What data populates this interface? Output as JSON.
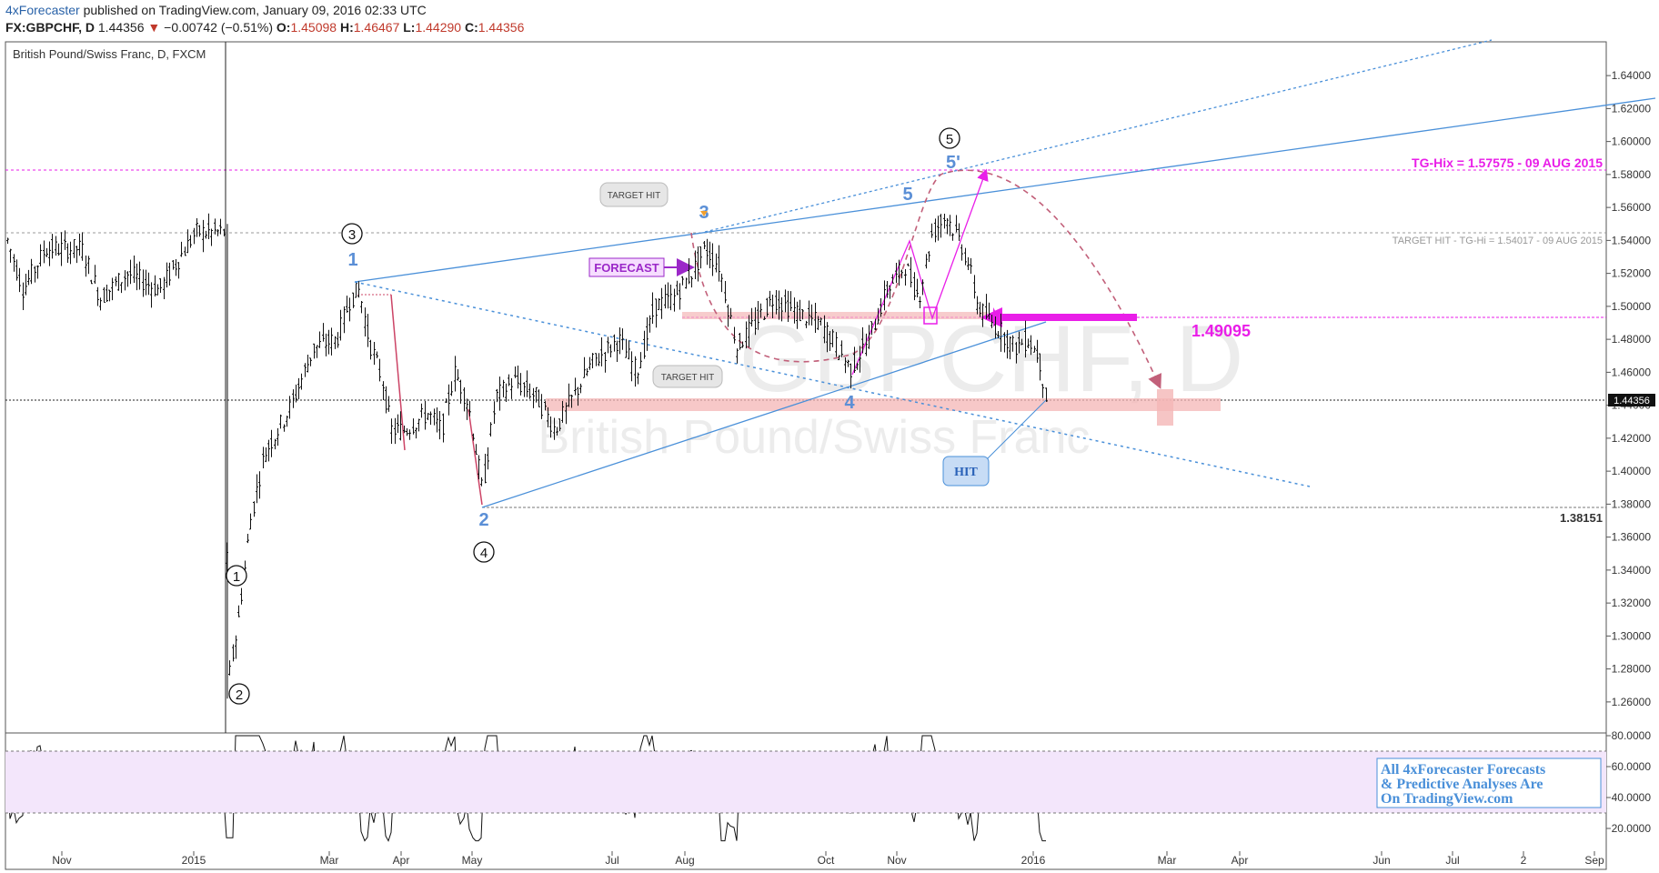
{
  "header": {
    "line1": {
      "author": "4xForecaster",
      "rest": " published on TradingView.com, January 09, 2016 02:33 UTC"
    },
    "line2": {
      "symbol": "FX:GBPCHF, D",
      "last": "1.44356",
      "arrow": "▼",
      "change": "−0.00742 (−0.51%)",
      "o_label": "O:",
      "o": "1.45098",
      "h_label": "H:",
      "h": "1.46467",
      "l_label": "L:",
      "l": "1.44290",
      "c_label": "C:",
      "c": "1.44356"
    }
  },
  "chart_data": {
    "type": "candlestick",
    "title": "British Pound/Swiss Franc, D, FXCM",
    "watermark_symbol": "GBPCHF, D",
    "watermark_name": "British Pound/Swiss Franc",
    "price_axis": {
      "min": 1.25,
      "max": 1.65,
      "ticks": [
        "1.64000",
        "1.62000",
        "1.60000",
        "1.58000",
        "1.56000",
        "1.54000",
        "1.52000",
        "1.50000",
        "1.48000",
        "1.46000",
        "1.44000",
        "1.42000",
        "1.40000",
        "1.38000",
        "1.36000",
        "1.34000",
        "1.32000",
        "1.30000",
        "1.28000",
        "1.26000"
      ]
    },
    "time_axis": [
      "Nov",
      "2015",
      "Mar",
      "Apr",
      "May",
      "Jul",
      "Aug",
      "Oct",
      "Nov",
      "2016",
      "Mar",
      "Apr",
      "Jun",
      "Jul",
      "2",
      "Sep"
    ],
    "last_price_label": "1.44356",
    "series": [
      {
        "x": [
          "Oct 2014",
          "Dec 2014",
          "Jan 15 2015",
          "Jan 16 2015",
          "Mar 2015",
          "Apr 2015",
          "May 2015",
          "Jun 2015",
          "Aug 2015",
          "Sep 2015",
          "Oct 2015",
          "Nov 2015",
          "Dec 2015",
          "Jan 2016"
        ],
        "y": [
          1.535,
          1.545,
          1.28,
          1.3,
          1.505,
          1.425,
          1.388,
          1.47,
          1.535,
          1.475,
          1.46,
          1.555,
          1.5,
          1.444
        ]
      }
    ],
    "levels": {
      "tg_hix": "TG-Hix = 1.57575 - 09 AUG 2015",
      "target_hit": "TARGET HIT - TG-Hi = 1.54017 - 09 AUG 2015",
      "pivot_label": "1.49095",
      "low_label": "1.38151"
    },
    "annotations": {
      "target_hit_1": "TARGET HIT",
      "target_hit_2": "TARGET HIT",
      "forecast": "FORECAST",
      "hit": "HIT",
      "wave_blue": [
        "1",
        "2",
        "3",
        "4",
        "5",
        "5'"
      ],
      "wave_circled": [
        "1",
        "2",
        "3",
        "4",
        "5"
      ]
    },
    "rsi": {
      "ticks": [
        "80.0000",
        "60.0000",
        "40.0000",
        "20.0000"
      ],
      "upper": 70,
      "lower": 30
    },
    "promo": [
      "All 4xForecaster Forecasts",
      "& Predictive Analyses Are",
      "On TradingView.com"
    ]
  },
  "colors": {
    "magenta": "#e91ee8",
    "blue": "#4a90d9",
    "wave_blue": "#5b8fd6",
    "pink": "#f4b6b6",
    "purple": "#9b28c8"
  }
}
